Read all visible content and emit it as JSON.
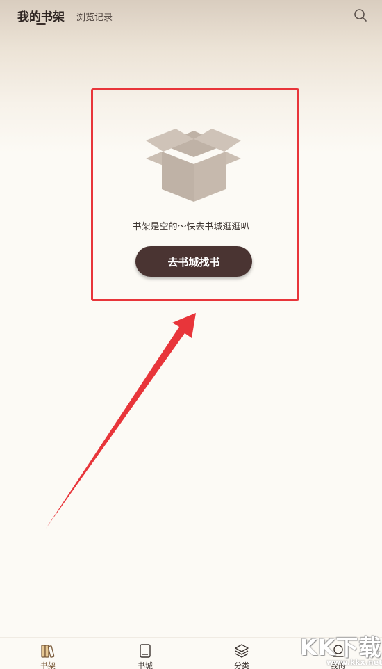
{
  "header": {
    "active_tab": "我的书架",
    "inactive_tab": "浏览记录",
    "search_icon": "search-icon"
  },
  "empty_state": {
    "icon": "open-box-icon",
    "message": "书架是空的～快去书城逛逛叭",
    "button_label": "去书城找书",
    "button_color": "#4a3432"
  },
  "annotation": {
    "color": "#e8353a"
  },
  "bottom_nav": {
    "items": [
      {
        "label": "书架",
        "icon": "bookshelf-icon",
        "active": true
      },
      {
        "label": "书城",
        "icon": "book-icon",
        "active": false
      },
      {
        "label": "分类",
        "icon": "layers-icon",
        "active": false
      },
      {
        "label": "我的",
        "icon": "profile-icon",
        "active": false
      }
    ]
  },
  "watermark": {
    "main": "KK下载",
    "sub": "www.kkx.net"
  }
}
